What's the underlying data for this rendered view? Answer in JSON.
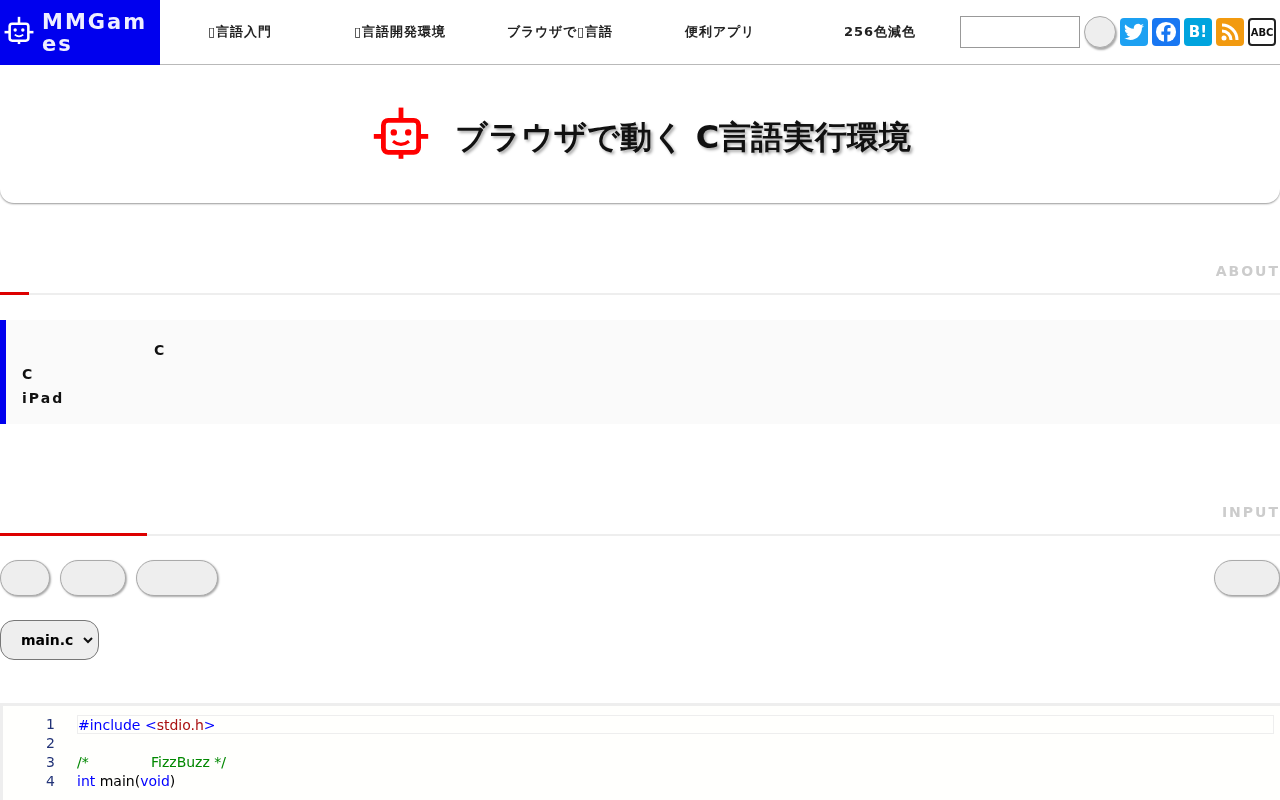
{
  "header": {
    "logo_text": "MMGames",
    "nav": [
      {
        "label": "▯言語入門"
      },
      {
        "label": "▯言語開発環境"
      },
      {
        "label": "ブラウザで▯言語"
      },
      {
        "label": "便利アプリ"
      },
      {
        "label": "256色減色"
      }
    ],
    "social": [
      {
        "kind": "twitter"
      },
      {
        "kind": "facebook"
      },
      {
        "kind": "hatena",
        "label": "B!"
      },
      {
        "kind": "rss"
      },
      {
        "kind": "abc",
        "label": "ABC"
      }
    ]
  },
  "banner": {
    "title": "ブラウザで動く C言語実行環境"
  },
  "about": {
    "heading": "ABOUT",
    "lines": [
      "C",
      "C",
      "iPad"
    ]
  },
  "input": {
    "heading": "INPUT",
    "file_select": {
      "value": "main.c"
    }
  },
  "editor": {
    "lines": [
      {
        "number": "1",
        "current": true,
        "tokens": [
          {
            "kind": "keyword",
            "text": "#include "
          },
          {
            "kind": "keyword",
            "text": "<"
          },
          {
            "kind": "string",
            "text": "stdio.h"
          },
          {
            "kind": "keyword",
            "text": ">"
          }
        ]
      },
      {
        "number": "2",
        "current": false
      },
      {
        "number": "3",
        "current": false,
        "tokens": [
          {
            "kind": "comment",
            "text": "/*              FizzBuzz */"
          }
        ]
      },
      {
        "number": "4",
        "current": false,
        "tokens": [
          {
            "kind": "keyword",
            "text": "int"
          },
          {
            "kind": "plain",
            "text": " main("
          },
          {
            "kind": "keyword",
            "text": "void"
          },
          {
            "kind": "plain",
            "text": ")"
          }
        ]
      }
    ]
  }
}
